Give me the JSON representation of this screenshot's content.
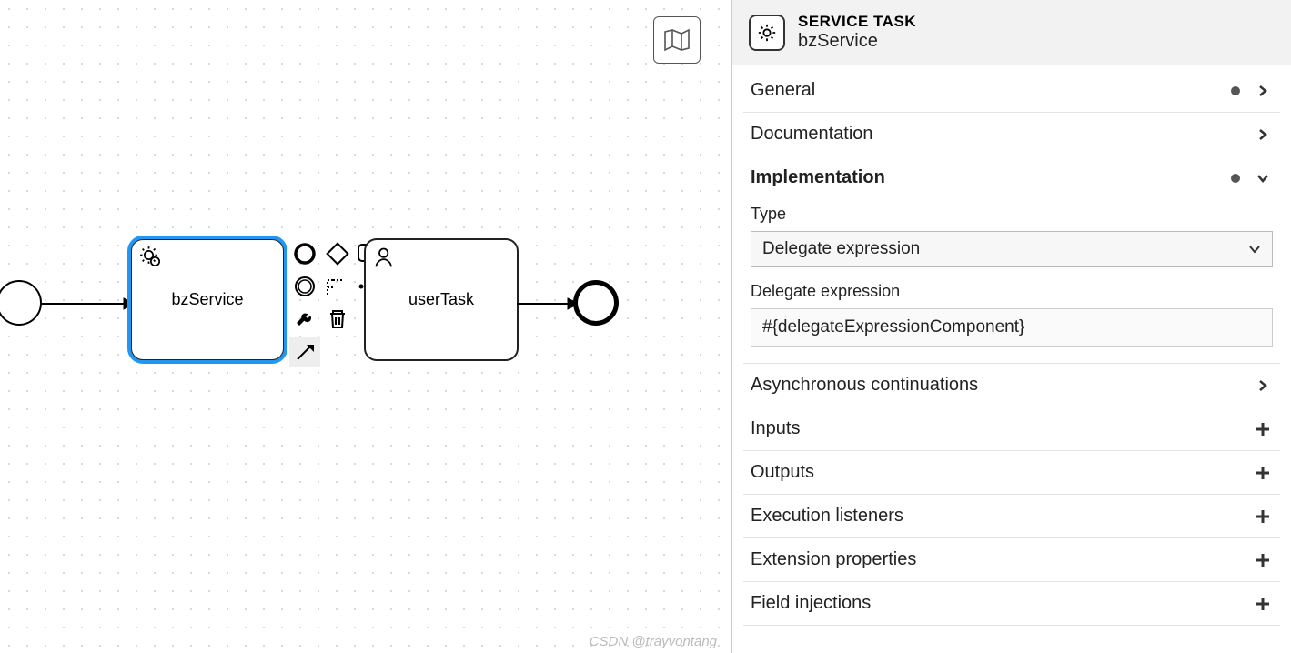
{
  "header": {
    "type_label": "SERVICE TASK",
    "name": "bzService"
  },
  "canvas": {
    "service_task_label": "bzService",
    "user_task_label": "userTask"
  },
  "sections": {
    "general": {
      "title": "General",
      "has_dot": true,
      "action": "chevron"
    },
    "documentation": {
      "title": "Documentation",
      "action": "chevron"
    },
    "implementation": {
      "title": "Implementation",
      "has_dot": true,
      "action": "chevron-down",
      "type_label": "Type",
      "type_value": "Delegate expression",
      "expr_label": "Delegate expression",
      "expr_value": "#{delegateExpressionComponent}"
    },
    "async": {
      "title": "Asynchronous continuations",
      "action": "chevron"
    },
    "inputs": {
      "title": "Inputs",
      "action": "plus"
    },
    "outputs": {
      "title": "Outputs",
      "action": "plus"
    },
    "exec_listeners": {
      "title": "Execution listeners",
      "action": "plus"
    },
    "extension_props": {
      "title": "Extension properties",
      "action": "plus"
    },
    "field_injections": {
      "title": "Field injections",
      "action": "plus"
    }
  },
  "watermark": "CSDN @trayvontang"
}
